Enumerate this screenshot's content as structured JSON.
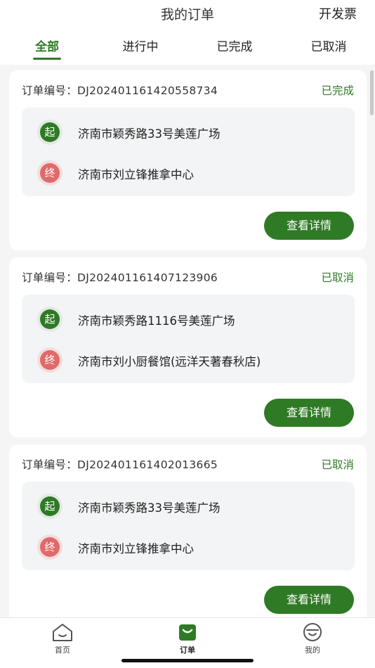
{
  "header": {
    "title": "我的订单",
    "invoice_label": "开发票"
  },
  "tabs": [
    {
      "label": "全部",
      "active": true
    },
    {
      "label": "进行中",
      "active": false
    },
    {
      "label": "已完成",
      "active": false
    },
    {
      "label": "已取消",
      "active": false
    }
  ],
  "orders": [
    {
      "number": "订单编号：DJ202401161420558734",
      "status": "已完成",
      "start_badge": "起",
      "start": "济南市颖秀路33号美莲广场",
      "end_badge": "终",
      "end": "济南市刘立锋推拿中心",
      "detail_label": "查看详情"
    },
    {
      "number": "订单编号：DJ202401161407123906",
      "status": "已取消",
      "start_badge": "起",
      "start": "济南市颖秀路1116号美莲广场",
      "end_badge": "终",
      "end": "济南市刘小厨餐馆(远洋天著春秋店)",
      "detail_label": "查看详情"
    },
    {
      "number": "订单编号：DJ202401161402013665",
      "status": "已取消",
      "start_badge": "起",
      "start": "济南市颖秀路33号美莲广场",
      "end_badge": "终",
      "end": "济南市刘立锋推拿中心",
      "detail_label": "查看详情"
    }
  ],
  "nav": [
    {
      "label": "首页",
      "icon": "home-icon"
    },
    {
      "label": "订单",
      "icon": "bag-icon",
      "active": true
    },
    {
      "label": "我的",
      "icon": "smile-icon"
    }
  ],
  "colors": {
    "accent": "#2f7a25",
    "end_badge": "#e06a6a",
    "background": "#f5f5f5"
  }
}
